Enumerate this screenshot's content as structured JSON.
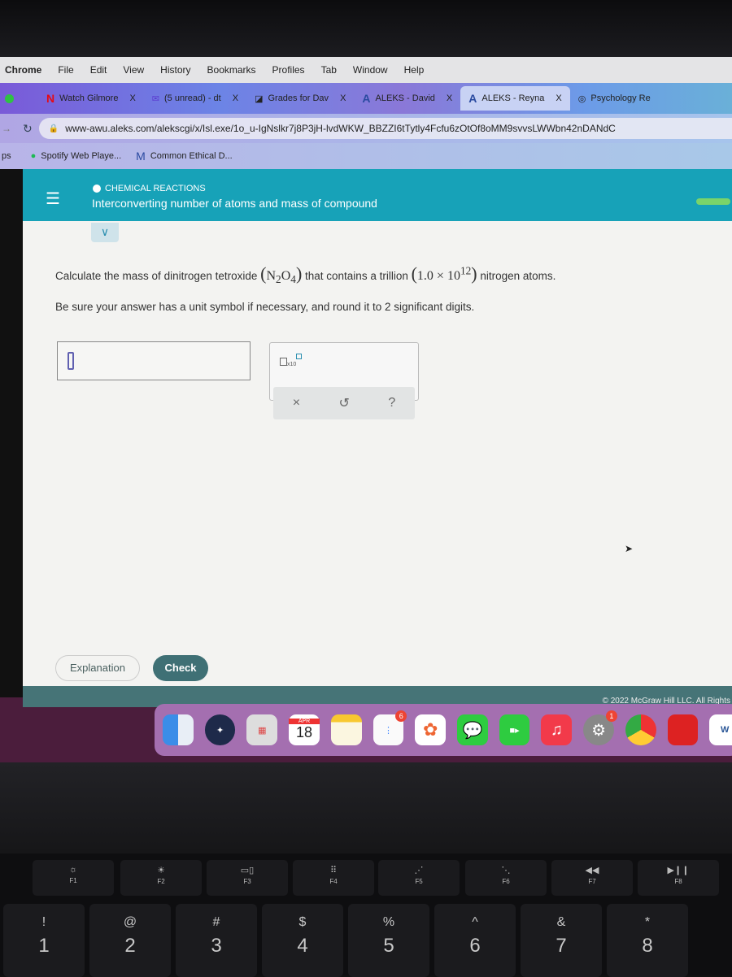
{
  "menubar": {
    "app": "Chrome",
    "items": [
      "File",
      "Edit",
      "View",
      "History",
      "Bookmarks",
      "Profiles",
      "Tab",
      "Window",
      "Help"
    ]
  },
  "tabs": [
    {
      "label": "Watch Gilmore",
      "icon": "netflix-icon",
      "close": "X"
    },
    {
      "label": "(5 unread) - dt",
      "icon": "mail-icon",
      "close": "X"
    },
    {
      "label": "Grades for Dav",
      "icon": "grades-icon",
      "close": "X"
    },
    {
      "label": "ALEKS - David",
      "icon": "aleks-icon",
      "close": "X"
    },
    {
      "label": "ALEKS - Reyna",
      "icon": "aleks-icon",
      "close": "X",
      "active": true
    },
    {
      "label": "Psychology Re",
      "icon": "chrome-icon"
    }
  ],
  "address": {
    "url": "www-awu.aleks.com/alekscgi/x/Isl.exe/1o_u-IgNslkr7j8P3jH-lvdWKW_BBZZI6tTytly4Fcfu6zOtOf8oMM9svvsLWWbn42nDANdC"
  },
  "bookmarks": {
    "apps": "ps",
    "items": [
      "Spotify Web Playe...",
      "Common Ethical D..."
    ]
  },
  "header": {
    "category": "CHEMICAL REACTIONS",
    "title": "Interconverting number of atoms and mass of compound"
  },
  "question": {
    "pre": "Calculate the mass of dinitrogen tetroxide ",
    "formula_open": "(",
    "n": "N",
    "n_sub": "2",
    "o": "O",
    "o_sub": "4",
    "formula_close": ")",
    "mid": " that contains a trillion ",
    "sci_open": "(",
    "mantissa": "1.0 × 10",
    "exp": "12",
    "sci_close": ")",
    "post": " nitrogen atoms.",
    "note": "Be sure your answer has a unit symbol if necessary, and round it to 2 significant digits."
  },
  "answer": {
    "value": ""
  },
  "tools": {
    "sci_label": "x10",
    "clear": "×",
    "undo": "↺",
    "help": "?"
  },
  "buttons": {
    "explanation": "Explanation",
    "check": "Check"
  },
  "footer": "© 2022 McGraw Hill LLC. All Rights",
  "dock": {
    "calendar_month": "APR",
    "calendar_day": "18",
    "reminders_badge": "6",
    "settings_badge": "1",
    "word_label": "W"
  },
  "keyboard": {
    "fkeys": [
      "F1",
      "F2",
      "F3",
      "F4",
      "F5",
      "F6",
      "F7",
      "F8"
    ],
    "fglyphs": [
      "☼",
      "☀",
      "▭▯",
      "⠿",
      "⋰",
      "⋱",
      "◀◀",
      "▶❙❙"
    ],
    "number_keys": [
      {
        "top": "!",
        "n": "1"
      },
      {
        "top": "@",
        "n": "2"
      },
      {
        "top": "#",
        "n": "3"
      },
      {
        "top": "$",
        "n": "4"
      },
      {
        "top": "%",
        "n": "5"
      },
      {
        "top": "^",
        "n": "6"
      },
      {
        "top": "&",
        "n": "7"
      },
      {
        "top": "*",
        "n": "8"
      }
    ]
  }
}
